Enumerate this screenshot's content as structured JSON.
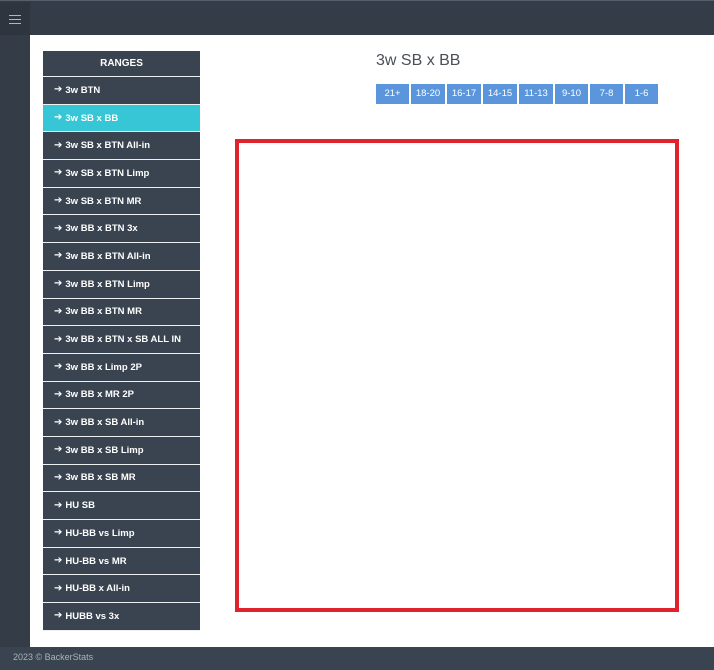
{
  "sidebar": {
    "header": "RANGES",
    "items": [
      {
        "label": "3w BTN"
      },
      {
        "label": "3w SB x BB",
        "active": true
      },
      {
        "label": "3w SB x BTN All-in"
      },
      {
        "label": "3w SB x BTN Limp"
      },
      {
        "label": "3w SB x BTN MR"
      },
      {
        "label": "3w BB x BTN 3x"
      },
      {
        "label": "3w BB x BTN All-in"
      },
      {
        "label": "3w BB x BTN Limp"
      },
      {
        "label": "3w BB x BTN MR"
      },
      {
        "label": "3w BB x BTN x SB ALL IN"
      },
      {
        "label": "3w BB x Limp 2P"
      },
      {
        "label": "3w BB x MR 2P"
      },
      {
        "label": "3w BB x SB All-in"
      },
      {
        "label": "3w BB x SB Limp"
      },
      {
        "label": "3w BB x SB MR"
      },
      {
        "label": "HU SB"
      },
      {
        "label": "HU-BB vs Limp"
      },
      {
        "label": "HU-BB vs MR"
      },
      {
        "label": "HU-BB x All-in"
      },
      {
        "label": "HUBB vs 3x"
      }
    ]
  },
  "main": {
    "title": "3w SB x BB",
    "range_tabs": [
      "21+",
      "18-20",
      "16-17",
      "14-15",
      "11-13",
      "9-10",
      "7-8",
      "1-6"
    ]
  },
  "footer": {
    "text": "2023 © BackerStats"
  },
  "colors": {
    "sidebar_bg": "#3a4350",
    "active_item": "#37c6d6",
    "tab_bg": "#5b96dd",
    "canvas_border": "#e0222d"
  },
  "icons": {
    "menu": "hamburger-icon",
    "item_arrow": "arrow-right-icon"
  }
}
